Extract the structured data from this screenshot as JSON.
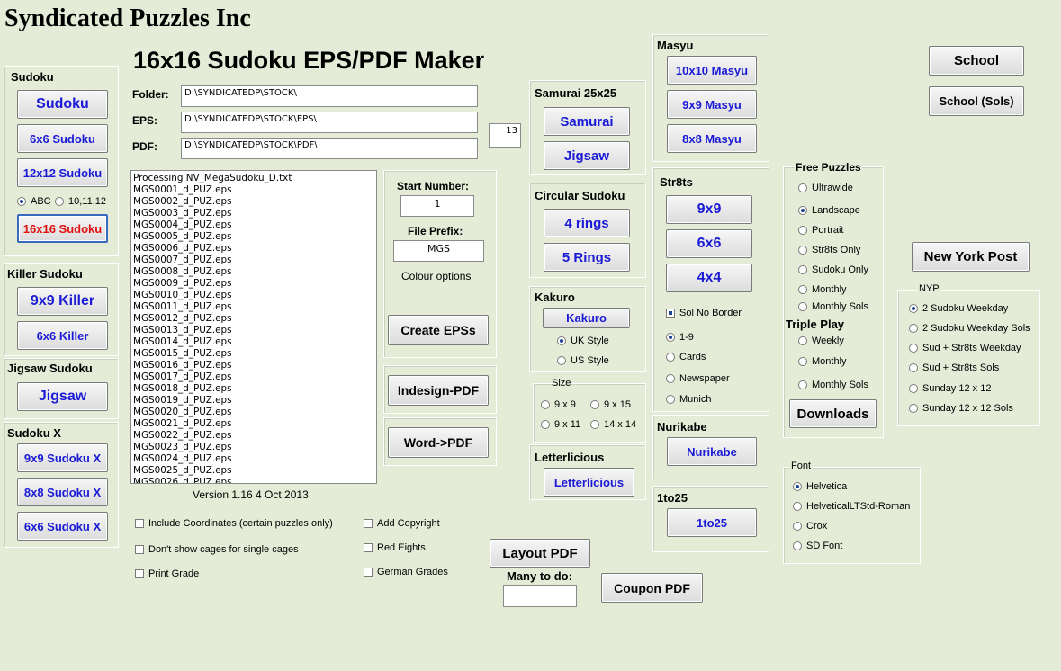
{
  "company_title": "Syndicated Puzzles Inc",
  "app_title": "16x16 Sudoku EPS/PDF Maker",
  "paths": {
    "folder_label": "Folder:",
    "folder_value": "D:\\SYNDICATEDP\\STOCK\\",
    "eps_label": "EPS:",
    "eps_value": "D:\\SYNDICATEDP\\STOCK\\EPS\\",
    "pdf_label": "PDF:",
    "pdf_value": "D:\\SYNDICATEDP\\STOCK\\PDF\\",
    "count_value": "13"
  },
  "sudoku": {
    "title": "Sudoku",
    "btn_sudoku": "Sudoku",
    "btn_6x6": "6x6 Sudoku",
    "btn_12x12": "12x12 Sudoku",
    "radio_abc": "ABC",
    "radio_101112": "10,11,12",
    "btn_16x16": "16x16 Sudoku"
  },
  "killer": {
    "title": "Killer Sudoku",
    "btn_9x9": "9x9 Killer",
    "btn_6x6": "6x6 Killer"
  },
  "jigsaw": {
    "title": "Jigsaw Sudoku",
    "btn": "Jigsaw"
  },
  "sudokux": {
    "title": "Sudoku X",
    "btn_9x9": "9x9 Sudoku X",
    "btn_8x8": "8x8 Sudoku X",
    "btn_6x6": "6x6 Sudoku X"
  },
  "log": {
    "lines": [
      "Processing NV_MegaSudoku_D.txt",
      "MGS0001_d_PUZ.eps",
      "MGS0002_d_PUZ.eps",
      "MGS0003_d_PUZ.eps",
      "MGS0004_d_PUZ.eps",
      "MGS0005_d_PUZ.eps",
      "MGS0006_d_PUZ.eps",
      "MGS0007_d_PUZ.eps",
      "MGS0008_d_PUZ.eps",
      "MGS0009_d_PUZ.eps",
      "MGS0010_d_PUZ.eps",
      "MGS0011_d_PUZ.eps",
      "MGS0012_d_PUZ.eps",
      "MGS0013_d_PUZ.eps",
      "MGS0014_d_PUZ.eps",
      "MGS0015_d_PUZ.eps",
      "MGS0016_d_PUZ.eps",
      "MGS0017_d_PUZ.eps",
      "MGS0018_d_PUZ.eps",
      "MGS0019_d_PUZ.eps",
      "MGS0020_d_PUZ.eps",
      "MGS0021_d_PUZ.eps",
      "MGS0022_d_PUZ.eps",
      "MGS0023_d_PUZ.eps",
      "MGS0024_d_PUZ.eps",
      "MGS0025_d_PUZ.eps",
      "MGS0026_d_PUZ.eps"
    ]
  },
  "version": "Version 1.16 4 Oct 2013",
  "gen": {
    "start_label": "Start Number:",
    "start_value": "1",
    "prefix_label": "File Prefix:",
    "prefix_value": "MGS",
    "colour_label": "Colour options",
    "create_btn": "Create EPSs",
    "indesign_btn": "Indesign-PDF",
    "word_btn": "Word->PDF"
  },
  "options": {
    "include_coords": "Include Coordinates (certain puzzles only)",
    "no_cages": "Don't show cages for single cages",
    "print_grade": "Print Grade",
    "add_copyright": "Add Copyright",
    "red_eights": "Red Eights",
    "german_grades": "German Grades"
  },
  "layout_pdf": "Layout PDF",
  "many_label": "Many to do:",
  "many_value": "",
  "coupon_pdf": "Coupon PDF",
  "samurai": {
    "title": "Samurai 25x25",
    "btn_samurai": "Samurai",
    "btn_jigsaw": "Jigsaw"
  },
  "circular": {
    "title": "Circular Sudoku",
    "btn_4": "4 rings",
    "btn_5": "5 Rings"
  },
  "kakuro": {
    "title": "Kakuro",
    "btn": "Kakuro",
    "uk": "UK Style",
    "us": "US Style"
  },
  "size": {
    "title": "Size",
    "s9x9": "9 x 9",
    "s9x15": "9 x 15",
    "s9x11": "9 x 11",
    "s14x14": "14 x 14"
  },
  "letterlicious": {
    "title": "Letterlicious",
    "btn": "Letterlicious"
  },
  "masyu": {
    "title": "Masyu",
    "btn_10": "10x10 Masyu",
    "btn_9": "9x9 Masyu",
    "btn_8": "8x8 Masyu"
  },
  "str8ts": {
    "title": "Str8ts",
    "btn_9": "9x9",
    "btn_6": "6x6",
    "btn_4": "4x4",
    "sol_no_border": "Sol No Border",
    "r19": "1-9",
    "cards": "Cards",
    "newspaper": "Newspaper",
    "munich": "Munich"
  },
  "nurikabe": {
    "title": "Nurikabe",
    "btn": "Nurikabe"
  },
  "oneto25": {
    "title": "1to25",
    "btn": "1to25"
  },
  "free": {
    "title": "Free Puzzles",
    "ultrawide": "Ultrawide",
    "landscape": "Landscape",
    "portrait": "Portrait",
    "str8ts_only": "Str8ts Only",
    "sudoku_only": "Sudoku Only",
    "monthly": "Monthly",
    "monthly_sols": "Monthly Sols"
  },
  "triple": {
    "title": "Triple Play",
    "weekly": "Weekly",
    "monthly": "Monthly",
    "monthly_sols": "Monthly Sols"
  },
  "downloads": "Downloads",
  "school": "School",
  "school_sols": "School (Sols)",
  "nyp": {
    "btn": "New York Post",
    "group": "NYP",
    "o1": "2 Sudoku Weekday",
    "o2": "2 Sudoku Weekday Sols",
    "o3": "Sud + Str8ts Weekday",
    "o4": "Sud + Str8ts Sols",
    "o5": "Sunday 12 x 12",
    "o6": "Sunday 12 x 12 Sols"
  },
  "font": {
    "group": "Font",
    "o1": "Helvetica",
    "o2": "HelveticalLTStd-Roman",
    "o3": "Crox",
    "o4": "SD Font"
  }
}
